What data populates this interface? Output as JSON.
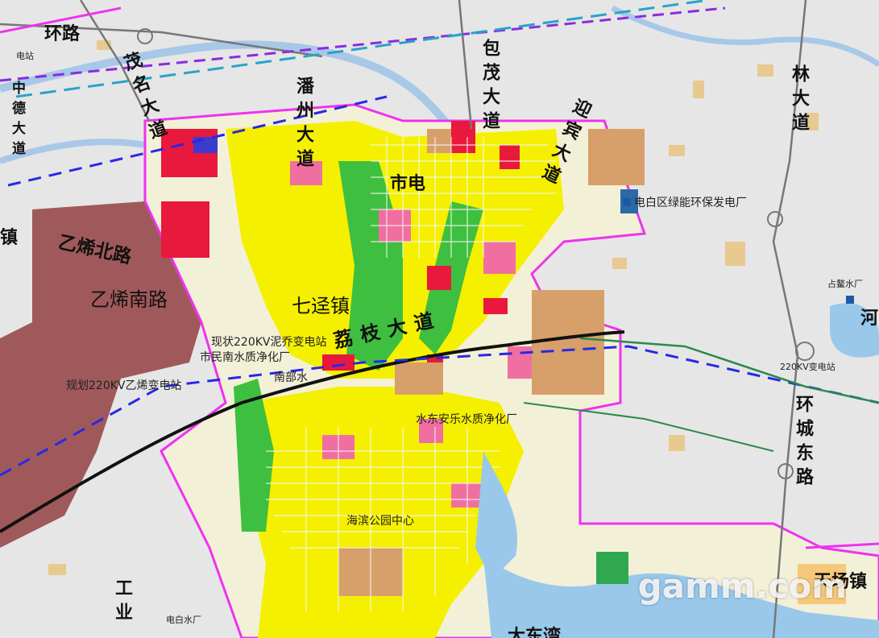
{
  "map": {
    "roads": {
      "huan_lu": "环路",
      "zhong_de": "中德大道",
      "mao_ming": "茂名大道",
      "pan_zhou": "潘州大道",
      "bao_mao": "包茂大道",
      "shi_dian": "市电",
      "ying_bin": "迎宾大道",
      "lin_da": "林大道",
      "yi_xi_bei": "乙烯北路",
      "yi_xi_nan": "乙烯南路",
      "li_zhi": "荔枝大道",
      "huan_cheng_dong": "环城东路"
    },
    "places": {
      "qi_jing": "七迳镇",
      "zhen_left": "镇",
      "gong_ye": "工业",
      "tian_xiang": "天场镇",
      "da_he": "大东湾",
      "he": "河",
      "west_station": "电站"
    },
    "facilities": {
      "power_plant": "电白区绿能环保发电厂",
      "substation_existing": "现状220KV泥乔变电站",
      "water_plant_south": "市民南水质净化厂",
      "nan_bu": "南部水",
      "substation_planned": "规划220KV乙烯变电站",
      "water_plant_east": "水东安乐水质净化厂",
      "water_plant_zhan": "占鳌水厂",
      "substation_east": "220KV变电站",
      "water_plant_dianbai": "电白水厂",
      "center": "海滨公园中心"
    },
    "watermark": "gamm.com"
  }
}
